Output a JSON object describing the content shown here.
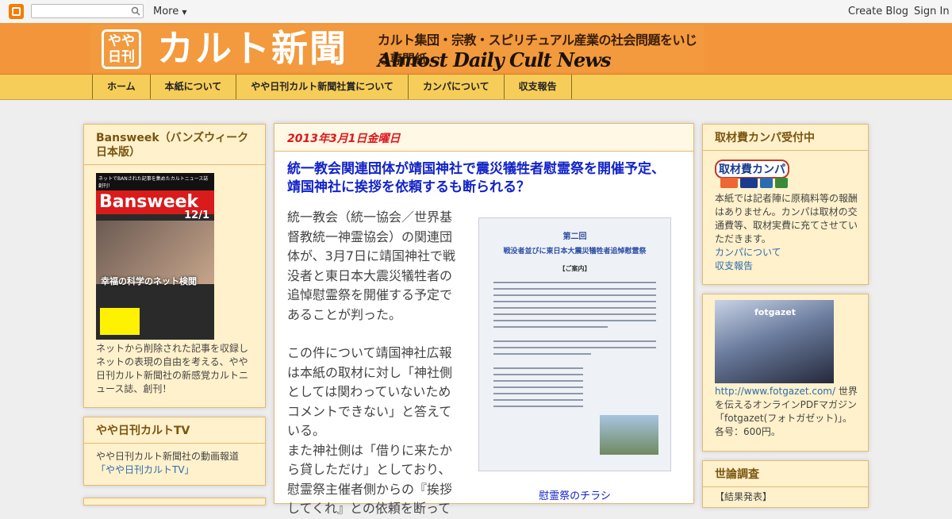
{
  "navbar": {
    "more_label": "More",
    "create_blog": "Create Blog",
    "sign_in": "Sign In"
  },
  "header": {
    "badge_line1": "やや",
    "badge_line2": "日刊",
    "title": "カルト新聞",
    "subtitle": "カルト集団・宗教・スピリチュアル産業の社会問題をいじる専門紙",
    "english": "Almost Daily Cult News"
  },
  "tabs": [
    "ホーム",
    "本紙について",
    "やや日刊カルト新聞社賞について",
    "カンパについて",
    "収支報告"
  ],
  "left": {
    "bansweek": {
      "title": "Bansweek（バンズウィーク日本版）",
      "cover_top": "ネットでBANされた記事を集めたカルトニュース誌創刊！",
      "cover_brand": "Bansweek",
      "cover_date": "12/1",
      "cover_headline": "幸福の科学のネット検閲",
      "description": "ネットから削除された記事を収録しネットの表現の自由を考える、やや日刊カルト新聞社の新感覚カルトニュース誌、創刊！"
    },
    "tv": {
      "title": "やや日刊カルトTV",
      "text": "やや日刊カルト新聞社の動画報道",
      "link": "「やや日刊カルトTV」"
    }
  },
  "post": {
    "date": "2013年3月1日金曜日",
    "title": "統一教会関連団体が靖国神社で震災犠牲者慰霊祭を開催予定、靖国神社に挨拶を依頼するも断られる？",
    "para1": "統一教会（統一協会／世界基督教統一神霊協会）の関連団体が、3月7日に靖国神社で戦没者と東日本大震災犠牲者の追悼慰霊祭を開催する予定であることが判った。",
    "para2": "この件について靖国神社広報は本紙の取材に対し「神社側としては関わっていないためコメントできない」と答えている。",
    "para3": "また神社側は「借りに来たから貸しただけ」としており、慰霊祭主催者側からの『挨拶してくれ』との依頼を断って",
    "flyer_title1": "第二回",
    "flyer_title2": "戦没者並びに東日本大震災犠牲者追悼慰霊祭",
    "flyer_title3": "【ご案内】",
    "flyer_caption": "慰霊祭のチラシ"
  },
  "right": {
    "kampa": {
      "title": "取材費カンパ受付中",
      "badge": "取材費カンパ",
      "text": "本紙では記者陣に原稿料等の報酬はありません。カンパは取材の交通費等、取材実費に充てさせていただきます。",
      "link1": "カンパについて",
      "link2": "収支報告"
    },
    "fotgazet": {
      "brand": "fotgazet",
      "link": "http://www.fotgazet.com/",
      "text": "世界を伝えるオンラインPDFマガジン「fotgazet(フォトガゼット)」。各号：600円。"
    },
    "poll": {
      "title": "世論調査",
      "result": "【結果発表】"
    }
  }
}
